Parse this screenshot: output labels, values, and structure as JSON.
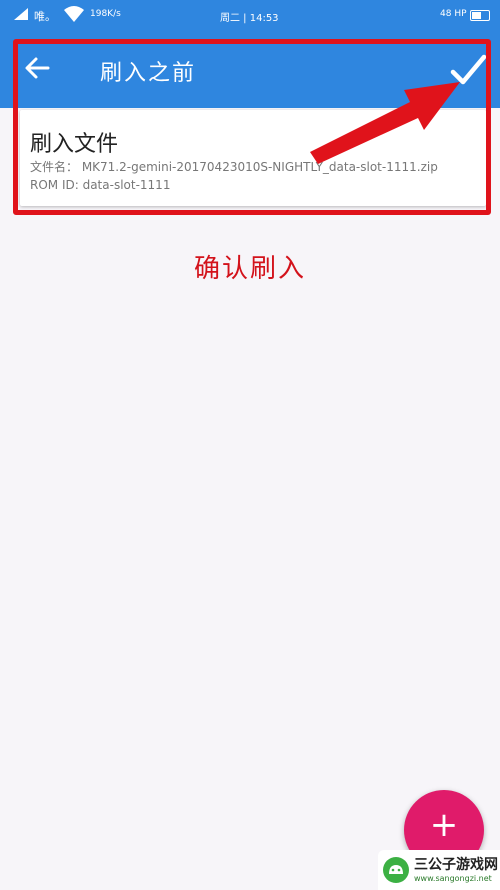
{
  "status_bar": {
    "carrier": "唯。",
    "speed": "198K/s",
    "time": "周二 | 14:53",
    "battery": "48 HP"
  },
  "app_bar": {
    "title": "刷入之前",
    "back_icon": "arrow-left-icon",
    "confirm_icon": "checkmark-icon"
  },
  "card": {
    "heading": "刷入文件",
    "file_name": "文件名： MK71.2-gemini-20170423010S-NIGHTLY_data-slot-1111.zip",
    "rom_id": "ROM ID: data-slot-1111"
  },
  "annotation": {
    "text": "确认刷入",
    "color": "#d3121b"
  },
  "fab": {
    "label": "+"
  },
  "watermark": {
    "name": "三公子游戏网",
    "url": "www.sangongzi.net"
  },
  "colors": {
    "primary": "#2f86df",
    "highlight": "#e0131b",
    "fab": "#e01b6a"
  }
}
